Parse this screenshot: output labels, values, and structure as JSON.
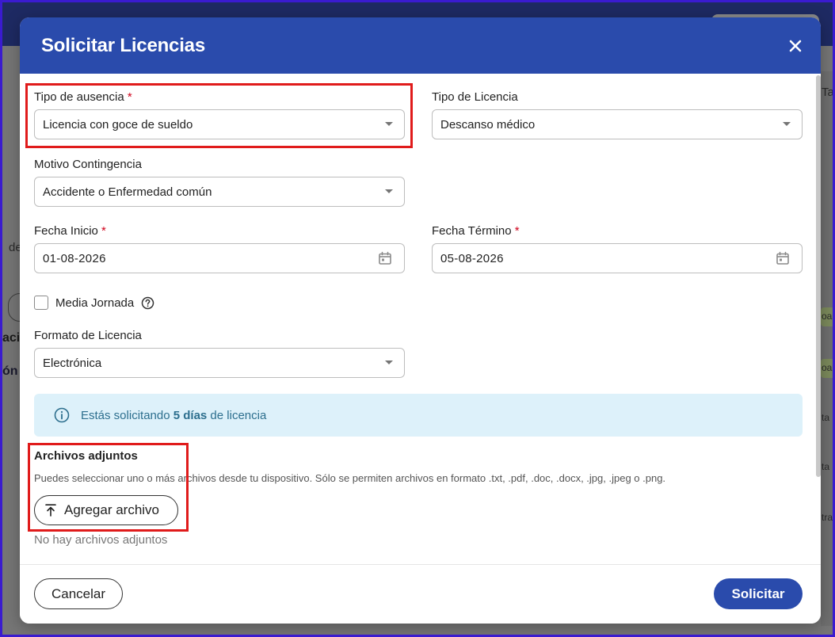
{
  "modal": {
    "title": "Solicitar Licencias"
  },
  "form": {
    "tipo_ausencia": {
      "label": "Tipo de ausencia",
      "required_mark": "*",
      "value": "Licencia con goce de sueldo"
    },
    "tipo_licencia": {
      "label": "Tipo de Licencia",
      "value": "Descanso médico"
    },
    "motivo_contingencia": {
      "label": "Motivo Contingencia",
      "value": "Accidente o Enfermedad común"
    },
    "fecha_inicio": {
      "label": "Fecha Inicio",
      "required_mark": "*",
      "value": "01-08-2026"
    },
    "fecha_termino": {
      "label": "Fecha Término",
      "required_mark": "*",
      "value": "05-08-2026"
    },
    "media_jornada": {
      "label": "Media Jornada",
      "checked": false
    },
    "formato_licencia": {
      "label": "Formato de Licencia",
      "value": "Electrónica"
    }
  },
  "info": {
    "prefix": "Estás solicitando ",
    "days": "5 días",
    "suffix": " de licencia"
  },
  "attachments": {
    "title": "Archivos adjuntos",
    "help": "Puedes seleccionar uno o más archivos desde tu dispositivo. Sólo se permiten archivos en formato .txt, .pdf, .doc, .docx, .jpg, .jpeg o .png.",
    "add_label": "Agregar archivo",
    "empty_text": "No hay archivos adjuntos"
  },
  "footer": {
    "cancel_label": "Cancelar",
    "submit_label": "Solicitar"
  },
  "background": {
    "fragments": [
      "Ta",
      "de",
      "aci",
      "ón",
      "oa",
      "oa",
      "ta",
      "ta",
      "tra"
    ]
  },
  "colors": {
    "header": "#2a4bac",
    "highlight": "#e01b1b",
    "info_bg": "#ddf1fa",
    "info_text": "#2d6f8e",
    "required": "#d0021b"
  },
  "icons": {
    "close": "close-icon",
    "dropdown": "chevron-down-icon",
    "calendar": "calendar-icon",
    "help": "help-circle-icon",
    "info": "info-icon",
    "upload": "upload-icon"
  }
}
